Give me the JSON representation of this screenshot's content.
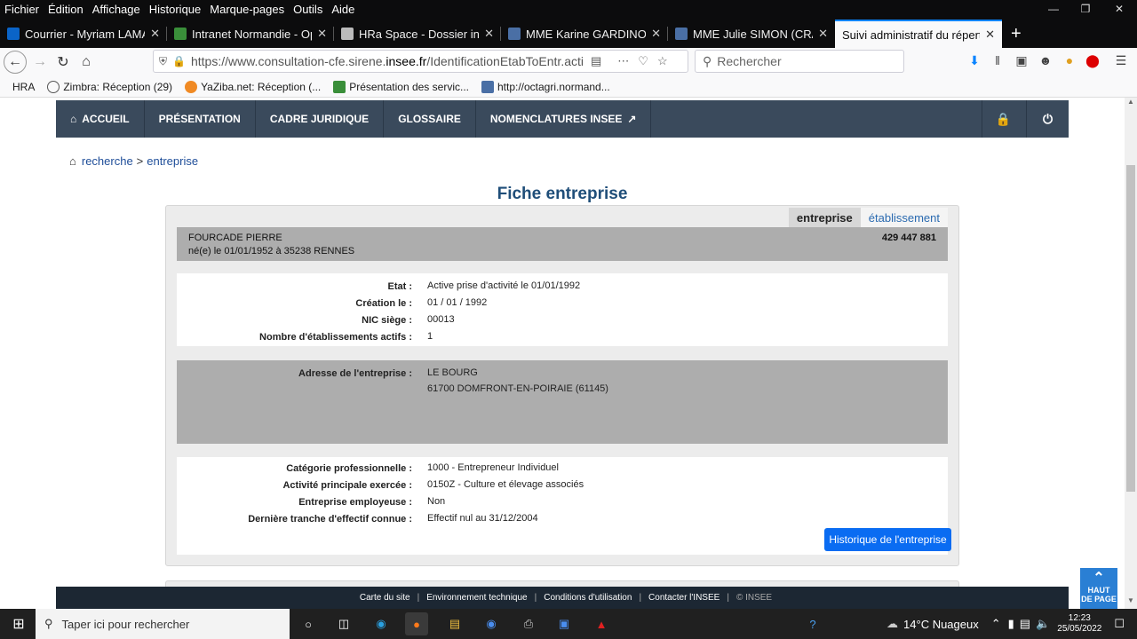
{
  "menubar": {
    "items": [
      "Fichier",
      "Édition",
      "Affichage",
      "Historique",
      "Marque-pages",
      "Outils",
      "Aide"
    ]
  },
  "tabs": [
    {
      "title": "Courrier - Myriam LAMAR",
      "color": "#0a64c8"
    },
    {
      "title": "Intranet Normandie - Ope",
      "color": "#3a8f3a"
    },
    {
      "title": "HRa Space - Dossier indiv",
      "color": "#bbbbbb"
    },
    {
      "title": "MME Karine GARDINOT (",
      "color": "#4a6fa5"
    },
    {
      "title": "MME Julie SIMON (CRAN",
      "color": "#4a6fa5"
    },
    {
      "title": "Suivi administratif du répertoi",
      "color": "#ffffff"
    }
  ],
  "urlbar": {
    "prefix": "https://www.consultation-cfe.sirene.",
    "host": "insee.fr",
    "path": "/IdentificationEtabToEntr.acti",
    "search_placeholder": "Rechercher"
  },
  "bookmarks": [
    {
      "label": "HRA",
      "color": "#3a8f3a"
    },
    {
      "label": "Zimbra: Réception (29)",
      "color": "#555555"
    },
    {
      "label": "YaZiba.net: Réception (...",
      "color": "#f08a24"
    },
    {
      "label": "Présentation des servic...",
      "color": "#3a8f3a"
    },
    {
      "label": "http://octagri.normand...",
      "color": "#4a6fa5"
    }
  ],
  "sitenav": {
    "items": [
      "ACCUEIL",
      "PRÉSENTATION",
      "CADRE JURIDIQUE",
      "GLOSSAIRE",
      "NOMENCLATURES INSEE"
    ]
  },
  "breadcrumb": {
    "home": "recherche",
    "sep": ">",
    "current": "entreprise"
  },
  "page_title": "Fiche entreprise",
  "card_tabs": {
    "active": "entreprise",
    "other": "établissement"
  },
  "identity": {
    "name": "FOURCADE PIERRE",
    "birth": "né(e) le 01/01/1952 à 35238 RENNES",
    "siren": "429 447 881"
  },
  "status_rows": [
    {
      "label": "Etat :",
      "value": "Active prise d'activité le 01/01/1992"
    },
    {
      "label": "Création le :",
      "value": "01 / 01 / 1992"
    },
    {
      "label": "NIC siège :",
      "value": "00013"
    },
    {
      "label": "Nombre d'établissements actifs :",
      "value": "1"
    }
  ],
  "address": {
    "label": "Adresse de l'entreprise :",
    "line1": "LE BOURG",
    "line2": "61700 DOMFRONT-EN-POIRAIE (61145)"
  },
  "activity_rows": [
    {
      "label": "Catégorie professionnelle :",
      "value": "1000 - Entrepreneur Individuel"
    },
    {
      "label": "Activité principale exercée :",
      "value": "0150Z - Culture et élevage associés"
    },
    {
      "label": "Entreprise employeuse :",
      "value": "Non"
    },
    {
      "label": "Dernière tranche d'effectif connue :",
      "value": "Effectif nul au 31/12/2004"
    }
  ],
  "history_button": "Historique de l'entreprise",
  "footer": {
    "links": [
      "Carte du site",
      "Environnement technique",
      "Conditions d'utilisation",
      "Contacter l'INSEE"
    ],
    "copyright": "© INSEE"
  },
  "haut_de_page": {
    "line1": "HAUT",
    "line2": "DE PAGE"
  },
  "taskbar": {
    "search_placeholder": "Taper ici pour rechercher",
    "weather": "14°C  Nuageux",
    "time": "12:23",
    "date": "25/05/2022"
  },
  "colors": {
    "nav": "#3a4a5c",
    "title": "#1f4e79",
    "button": "#0a6cf2",
    "accent_tab": "#0a84ff"
  }
}
